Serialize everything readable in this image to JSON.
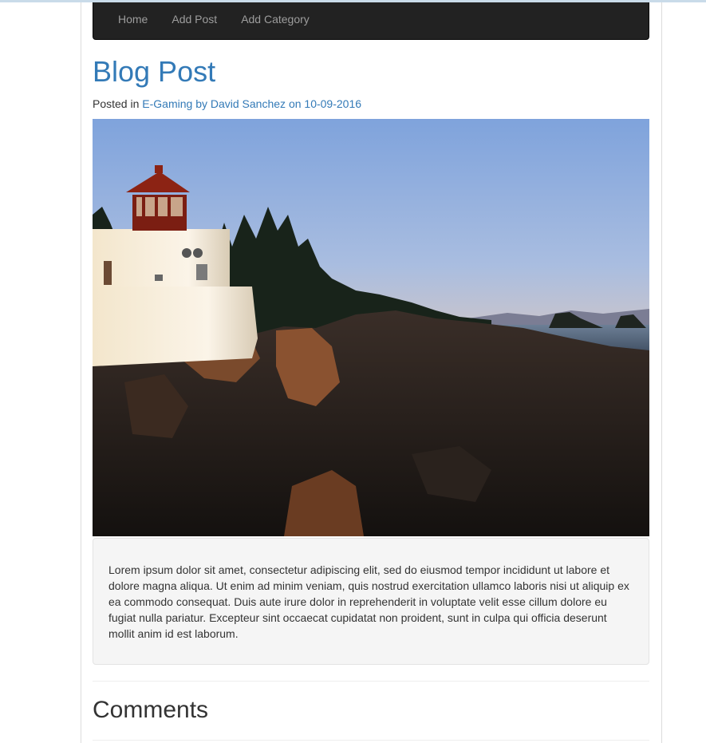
{
  "nav": {
    "items": [
      {
        "label": "Home"
      },
      {
        "label": "Add Post"
      },
      {
        "label": "Add Category"
      }
    ]
  },
  "post": {
    "title": "Blog Post",
    "meta_prefix": "Posted in",
    "category": "E-Gaming",
    "by_text": "by",
    "author": "David Sanchez",
    "on_text": "on",
    "date": "10-09-2016",
    "image": {
      "icon": "lighthouse-photo"
    },
    "body": "Lorem ipsum dolor sit amet, consectetur adipiscing elit, sed do eiusmod tempor incididunt ut labore et dolore magna aliqua. Ut enim ad minim veniam, quis nostrud exercitation ullamco laboris nisi ut aliquip ex ea commodo consequat. Duis aute irure dolor in reprehenderit in voluptate velit esse cillum dolore eu fugiat nulla pariatur. Excepteur sint occaecat cupidatat non proident, sunt in culpa qui officia deserunt mollit anim id est laborum."
  },
  "comments": {
    "title": "Comments"
  },
  "colors": {
    "link": "#337ab7",
    "navbar_bg": "#222222",
    "nav_text": "#9d9d9d",
    "well_bg": "#f5f5f5"
  }
}
